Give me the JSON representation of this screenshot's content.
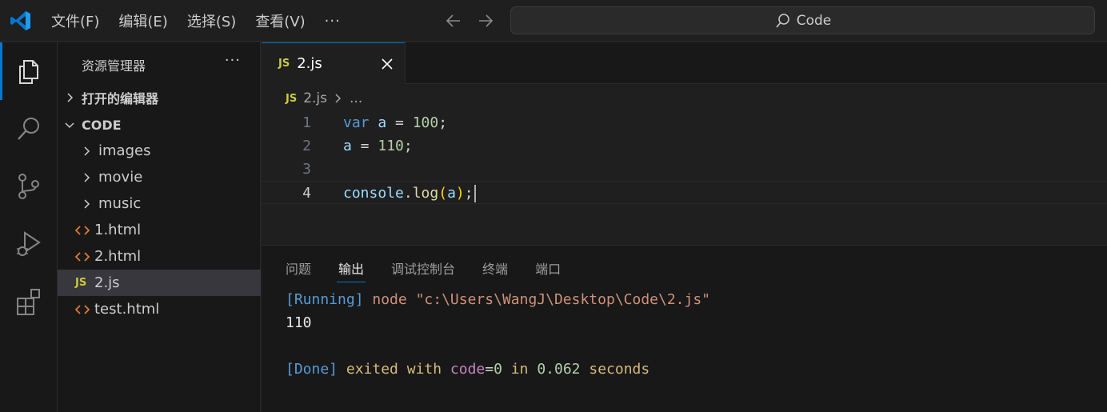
{
  "app": {
    "menu": [
      "文件(F)",
      "编辑(E)",
      "选择(S)",
      "查看(V)"
    ],
    "menu_more": "···",
    "search_text": "Code"
  },
  "sidebar": {
    "title": "资源管理器",
    "more": "···",
    "open_editors": "打开的编辑器",
    "workspace": "CODE",
    "folders": [
      "images",
      "movie",
      "music"
    ],
    "files": [
      {
        "name": "1.html",
        "type": "html"
      },
      {
        "name": "2.html",
        "type": "html"
      },
      {
        "name": "2.js",
        "type": "js",
        "selected": true
      },
      {
        "name": "test.html",
        "type": "html"
      }
    ]
  },
  "editor": {
    "tab_name": "2.js",
    "file_badge": "JS",
    "breadcrumb_file": "2.js",
    "breadcrumb_more": "...",
    "line_numbers": [
      "1",
      "2",
      "3",
      "4"
    ],
    "code": {
      "l1": {
        "kw": "var",
        "var": "a",
        "op": " = ",
        "num": "100",
        "end": ";"
      },
      "l2": {
        "var": "a",
        "op": " = ",
        "num": "110",
        "end": ";"
      },
      "l4": {
        "obj": "console",
        "dot": ".",
        "fn": "log",
        "open": "(",
        "arg": "a",
        "close": ")",
        "end": ";"
      }
    }
  },
  "panel": {
    "tabs": [
      "问题",
      "输出",
      "调试控制台",
      "终端",
      "端口"
    ],
    "active_tab": "输出",
    "output": {
      "running_tag": "[Running]",
      "command": " node \"c:\\Users\\WangJ\\Desktop\\Code\\2.js\"",
      "result": "110",
      "done_tag": "[Done]",
      "exited_with": " exited with ",
      "code_label": "code",
      "equals": "=",
      "code_value": "0",
      "in": " in ",
      "time": "0.062",
      "seconds": " seconds"
    }
  },
  "colors": {
    "accent": "#0078d4",
    "background": "#1f1f1f",
    "sidebar": "#181818",
    "js_badge": "#cbcb41",
    "html_badge": "#e37933"
  }
}
